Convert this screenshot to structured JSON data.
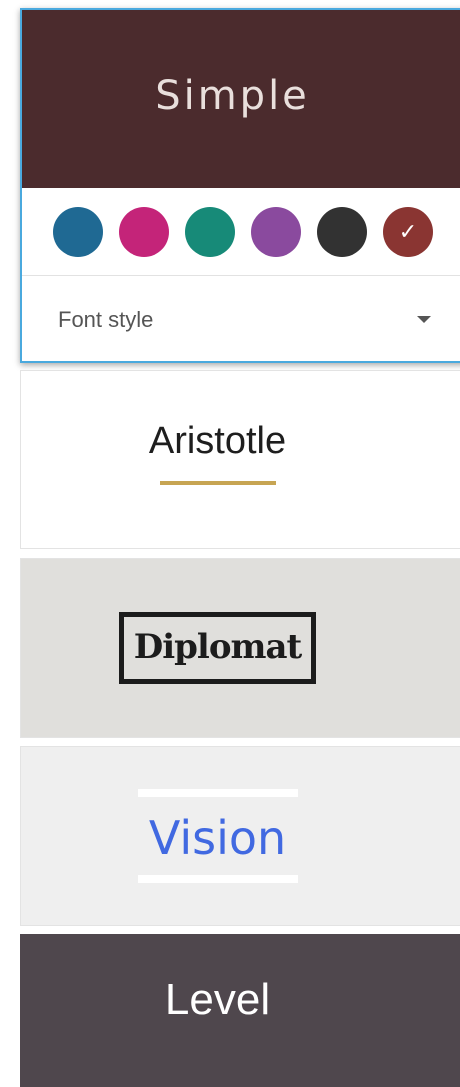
{
  "selected_theme": {
    "title": "Simple",
    "header_color": "#4b2b2d",
    "swatches": [
      {
        "name": "blue",
        "color": "#1f6993",
        "selected": false
      },
      {
        "name": "magenta",
        "color": "#c42479",
        "selected": false
      },
      {
        "name": "teal",
        "color": "#178a78",
        "selected": false
      },
      {
        "name": "purple",
        "color": "#8a4a9e",
        "selected": false
      },
      {
        "name": "charcoal",
        "color": "#323232",
        "selected": false
      },
      {
        "name": "maroon",
        "color": "#8a3532",
        "selected": true
      }
    ],
    "selected_icon": "check-icon",
    "font_style_label": "Font style",
    "dropdown_icon": "caret-down-icon"
  },
  "themes": [
    {
      "name": "Aristotle",
      "background": "#ffffff",
      "accent": "#c7a553"
    },
    {
      "name": "Diplomat",
      "background": "#e0dfdc",
      "accent": "#1c1c1c"
    },
    {
      "name": "Vision",
      "background": "#efefef",
      "accent": "#4169e1"
    },
    {
      "name": "Level",
      "background": "#4f474d",
      "accent": "#ffffff"
    }
  ]
}
